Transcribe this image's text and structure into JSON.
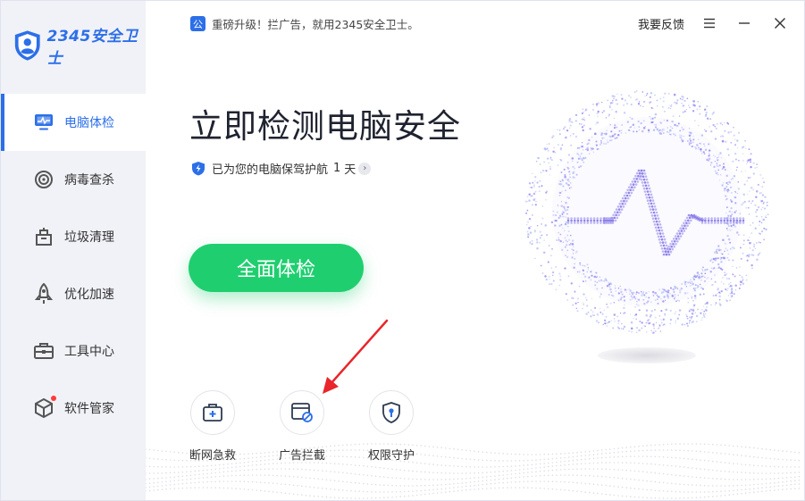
{
  "brand": {
    "name": "2345安全卫士",
    "color": "#2c6fe8"
  },
  "sidebar": {
    "items": [
      {
        "label": "电脑体检",
        "icon": "monitor-icon",
        "active": true
      },
      {
        "label": "病毒查杀",
        "icon": "target-icon",
        "active": false
      },
      {
        "label": "垃圾清理",
        "icon": "trash-bin-icon",
        "active": false
      },
      {
        "label": "优化加速",
        "icon": "rocket-icon",
        "active": false
      },
      {
        "label": "工具中心",
        "icon": "toolbox-icon",
        "active": false
      },
      {
        "label": "软件管家",
        "icon": "cube-icon",
        "active": false,
        "badge": true
      }
    ]
  },
  "topbar": {
    "notice_icon": "公",
    "notice": "重磅升级！拦广告，就用2345安全卫士。",
    "feedback": "我要反馈"
  },
  "main": {
    "headline": "立即检测电脑安全",
    "protect_prefix": "已为您的电脑保驾护航",
    "protect_days": "1",
    "protect_unit": "天",
    "scan_button": "全面体检",
    "scan_button_color": "#1fcf6f"
  },
  "tools": [
    {
      "label": "断网急救",
      "icon": "first-aid-kit-icon"
    },
    {
      "label": "广告拦截",
      "icon": "ad-block-icon"
    },
    {
      "label": "权限守护",
      "icon": "shield-lock-icon"
    }
  ]
}
